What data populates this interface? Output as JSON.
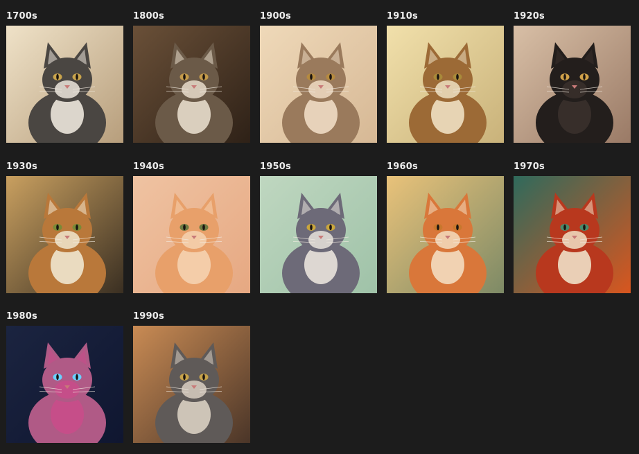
{
  "gallery": {
    "items": [
      {
        "label": "1700s",
        "colors": {
          "bg1": "#efe2c8",
          "bg2": "#b79e7c",
          "cat": "#4a4642",
          "chest": "#ece6dc",
          "eye": "#c9a44c"
        }
      },
      {
        "label": "1800s",
        "colors": {
          "bg1": "#6a5038",
          "bg2": "#2e2117",
          "cat": "#6b5a48",
          "chest": "#e7dccb",
          "eye": "#c39a4a"
        }
      },
      {
        "label": "1900s",
        "colors": {
          "bg1": "#efd9b9",
          "bg2": "#d6b895",
          "cat": "#9a7a5c",
          "chest": "#f0dcc4",
          "eye": "#b58a3f"
        }
      },
      {
        "label": "1910s",
        "colors": {
          "bg1": "#f1e0ab",
          "bg2": "#c9b27a",
          "cat": "#9c6a36",
          "chest": "#efe0c2",
          "eye": "#a98a3a"
        }
      },
      {
        "label": "1920s",
        "colors": {
          "bg1": "#d8bfa6",
          "bg2": "#9a7a66",
          "cat": "#231e1c",
          "chest": "#3a302c",
          "eye": "#d1a24a"
        }
      },
      {
        "label": "1930s",
        "colors": {
          "bg1": "#c9a060",
          "bg2": "#3a2f22",
          "cat": "#b9783a",
          "chest": "#f0e6cf",
          "eye": "#7a8a36"
        }
      },
      {
        "label": "1940s",
        "colors": {
          "bg1": "#efc3a2",
          "bg2": "#e6a882",
          "cat": "#e8a06a",
          "chest": "#f5d2b0",
          "eye": "#6f7b42"
        }
      },
      {
        "label": "1950s",
        "colors": {
          "bg1": "#bfd7c0",
          "bg2": "#9fc2a8",
          "cat": "#6d6a78",
          "chest": "#e9e3dc",
          "eye": "#c9a63d"
        }
      },
      {
        "label": "1960s",
        "colors": {
          "bg1": "#e9c27a",
          "bg2": "#7d8a66",
          "cat": "#d9773a",
          "chest": "#f3dcc0",
          "eye": "#c8772d"
        }
      },
      {
        "label": "1970s",
        "colors": {
          "bg1": "#2f6a5c",
          "bg2": "#d8561f",
          "cat": "#b8381e",
          "chest": "#f0e0c6",
          "eye": "#4b8a6a"
        }
      },
      {
        "label": "1980s",
        "colors": {
          "bg1": "#1b2440",
          "bg2": "#0f1630",
          "cat": "#b05a86",
          "chest": "#c94c8a",
          "eye": "#6ad0ff"
        }
      },
      {
        "label": "1990s",
        "colors": {
          "bg1": "#c98b54",
          "bg2": "#4a3528",
          "cat": "#5f5a58",
          "chest": "#d9cfc2",
          "eye": "#c6a24a"
        }
      }
    ]
  }
}
